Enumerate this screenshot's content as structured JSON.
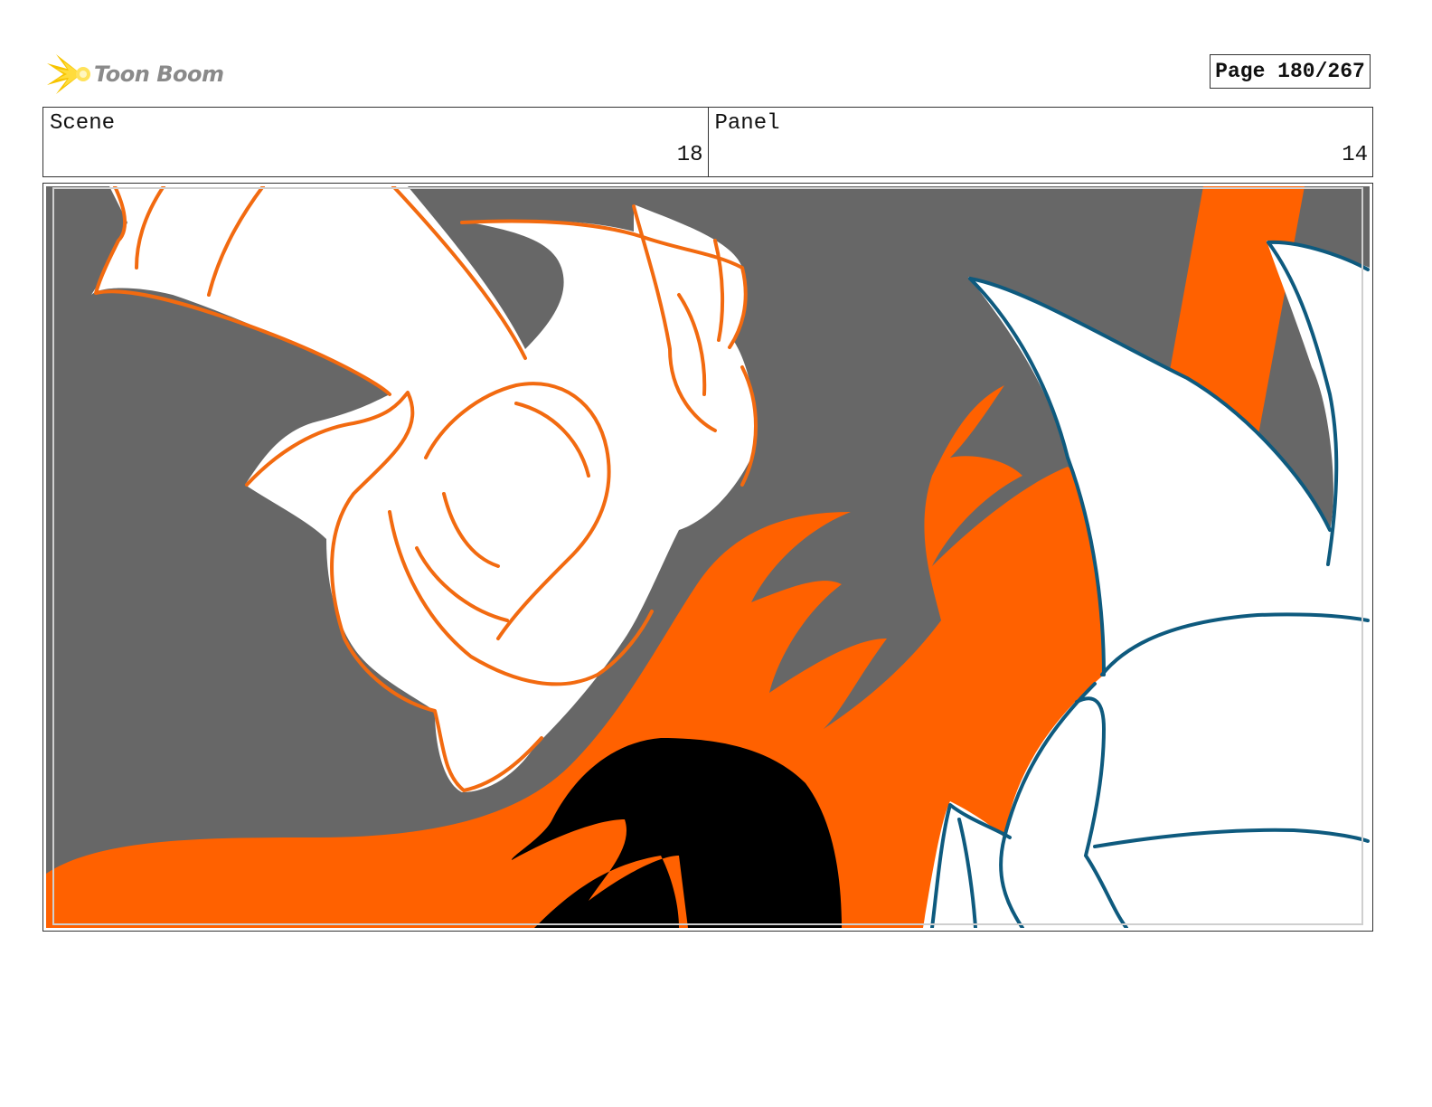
{
  "header": {
    "logo_text": "Toon Boom",
    "logo_icon": "starburst-icon",
    "page_counter": "Page 180/267"
  },
  "info": {
    "scene_label": "Scene",
    "scene_value": "18",
    "panel_label": "Panel",
    "panel_value": "14"
  },
  "panel_image": {
    "colors": {
      "background": "#676767",
      "fire": "#ff6100",
      "character_outline": "#f26a10",
      "dragon_outline": "#0e5a7e",
      "silhouette": "#000000",
      "fill": "#ffffff"
    }
  }
}
